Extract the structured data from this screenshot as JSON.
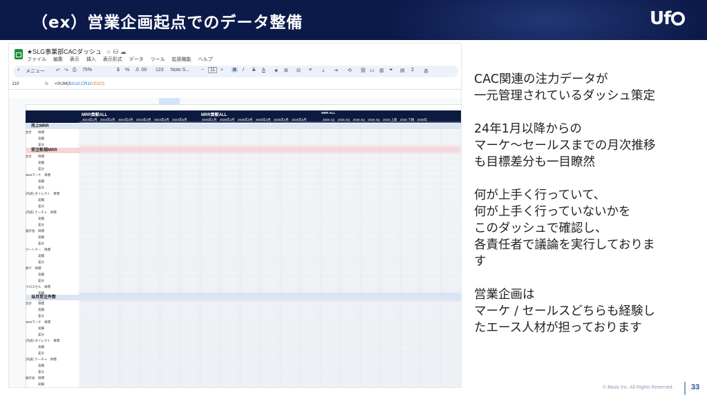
{
  "slide": {
    "title": "（ex）営業企画起点でのデータ整備",
    "logo_text": "Uf",
    "copyright": "© Basic Inc. All Rights Reserved.",
    "page_number": "33"
  },
  "sheet": {
    "doc_title": "★SLG事業部CACダッシュ",
    "doc_icons": "☆  ⛁  ☁",
    "menu": [
      "ファイル",
      "編集",
      "表示",
      "挿入",
      "表示形式",
      "データ",
      "ツール",
      "拡張機能",
      "ヘルプ"
    ],
    "toolbar": {
      "search": "メニュー",
      "zoom": "75%",
      "currency": "$",
      "percent": "%",
      "decimals": ".0  .00",
      "number_format": "123",
      "font": "Noto S...",
      "font_size": "11",
      "bold": "B",
      "italic": "I",
      "strike": "S",
      "text_color": "A"
    },
    "cell_ref": "J10",
    "formula_fx": "fx",
    "formula": {
      "prefix": "=SUM(",
      "range": "BA10,CR10",
      "suffix": ",EI10)"
    },
    "header_groups": [
      {
        "label": "MRR貢献ALL",
        "months": "2024年1月　2024年2月　2024年3月　2024年4月　2024年5月　2024年6月"
      },
      {
        "label": "MRR貢献ALL",
        "months": "2025年1月　2025年2月　2025年3月　2025年4月　2025年5月　2025年6月"
      },
      {
        "label": "MRR ALL",
        "months": "2025 1Q　2025 2Q　2025 3Q　2025 4Q　2025 上期　2025 下期　2025年"
      }
    ],
    "sections": {
      "sales_mrr": "売上MRR",
      "new_mrr": "受注新規MRR",
      "monthly_orders": "当月受注件数"
    },
    "row_labels_1": [
      "合計　　目標",
      "　　　　実績",
      "　　　　差分"
    ],
    "row_labels_2": [
      "合計　　目標",
      "　　　　実績",
      "　　　　差分",
      "Webマーケ　目標",
      "　　　　実績",
      "　　　　差分",
      "(内訳) ダイレクト　目標",
      "　　　　実績",
      "　　　　差分",
      "(内訳) ナーチャ　目標",
      "　　　　実績",
      "　　　　差分",
      "展示会　目標",
      "　　　　実績",
      "　　　　差分",
      "パートナー　目標",
      "　　　　実績",
      "　　　　差分",
      "紹介　目標",
      "　　　　実績",
      "　　　　差分",
      "クロスセル　目標",
      "　　　　実績",
      "　　　　差分"
    ],
    "row_labels_3": [
      "合計　　目標",
      "　　　　実績",
      "　　　　差分",
      "Webマーケ　目標",
      "　　　　実績",
      "　　　　差分",
      "(内訳) ダイレクト　目標",
      "　　　　実績",
      "　　　　差分",
      "(内訳) ナーチャ　目標",
      "　　　　実績",
      "　　　　差分",
      "展示会　目標",
      "　　　　実績"
    ]
  },
  "description": [
    {
      "lines": [
        "CAC関連の注力データが",
        "一元管理されているダッシュ策定"
      ]
    },
    {
      "lines": [
        "24年1月以降からの",
        "マーケ〜セールスまでの月次推移",
        "も目標差分も一目瞭然"
      ]
    },
    {
      "lines": [
        "何が上手く行っていて、",
        "何が上手く行っていないかを",
        "このダッシュで確認し、",
        "各責任者で議論を実行しておりま",
        "す"
      ]
    },
    {
      "lines": [
        "営業企画は",
        "マーケ / セールスどちらも経験し",
        "たエース人材が担っております"
      ]
    }
  ]
}
